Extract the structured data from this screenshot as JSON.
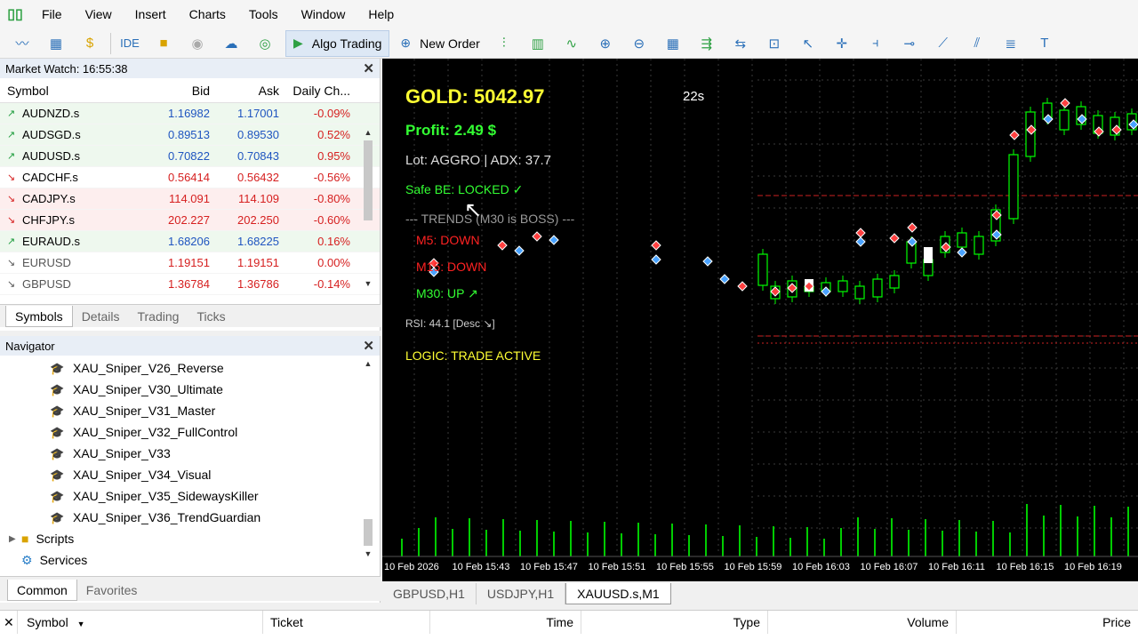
{
  "menu": [
    "File",
    "View",
    "Insert",
    "Charts",
    "Tools",
    "Window",
    "Help"
  ],
  "toolbar": {
    "ide": "IDE",
    "algo_trading": "Algo Trading",
    "new_order": "New Order"
  },
  "market_watch": {
    "title": "Market Watch: 16:55:38",
    "columns": [
      "Symbol",
      "Bid",
      "Ask",
      "Daily Ch..."
    ],
    "rows": [
      {
        "symbol": "AUDNZD.s",
        "bid": "1.16982",
        "ask": "1.17001",
        "change": "-0.09%",
        "dir": "up"
      },
      {
        "symbol": "AUDSGD.s",
        "bid": "0.89513",
        "ask": "0.89530",
        "change": "0.52%",
        "dir": "up"
      },
      {
        "symbol": "AUDUSD.s",
        "bid": "0.70822",
        "ask": "0.70843",
        "change": "0.95%",
        "dir": "up"
      },
      {
        "symbol": "CADCHF.s",
        "bid": "0.56414",
        "ask": "0.56432",
        "change": "-0.56%",
        "dir": "down"
      },
      {
        "symbol": "CADJPY.s",
        "bid": "114.091",
        "ask": "114.109",
        "change": "-0.80%",
        "dir": "down"
      },
      {
        "symbol": "CHFJPY.s",
        "bid": "202.227",
        "ask": "202.250",
        "change": "-0.60%",
        "dir": "down"
      },
      {
        "symbol": "EURAUD.s",
        "bid": "1.68206",
        "ask": "1.68225",
        "change": "0.16%",
        "dir": "up"
      },
      {
        "symbol": "EURUSD",
        "bid": "1.19151",
        "ask": "1.19151",
        "change": "0.00%",
        "dir": "down"
      },
      {
        "symbol": "GBPUSD",
        "bid": "1.36784",
        "ask": "1.36786",
        "change": "-0.14%",
        "dir": "down"
      }
    ],
    "tabs": [
      "Symbols",
      "Details",
      "Trading",
      "Ticks"
    ]
  },
  "navigator": {
    "title": "Navigator",
    "experts": [
      "XAU_Sniper_V26_Reverse",
      "XAU_Sniper_V30_Ultimate",
      "XAU_Sniper_V31_Master",
      "XAU_Sniper_V32_FullControl",
      "XAU_Sniper_V33",
      "XAU_Sniper_V34_Visual",
      "XAU_Sniper_V35_SidewaysKiller",
      "XAU_Sniper_V36_TrendGuardian"
    ],
    "scripts": "Scripts",
    "services": "Services",
    "tabs": [
      "Common",
      "Favorites"
    ]
  },
  "chart": {
    "gold": "GOLD: 5042.97",
    "timer": "22s",
    "profit": "Profit: 2.49 $",
    "lot": "Lot: AGGRO | ADX: 37.7",
    "safe_be": "Safe BE: LOCKED ✓",
    "trends": "--- TRENDS (M30 is BOSS) ---",
    "m5": "M5: DOWN",
    "m15": "M15: DOWN",
    "m30": "M30: UP ↗",
    "rsi": "RSI: 44.1 [Desc ↘]",
    "logic": "LOGIC: TRADE ACTIVE",
    "time_labels": [
      "10 Feb 2026",
      "10 Feb 15:43",
      "10 Feb 15:47",
      "10 Feb 15:51",
      "10 Feb 15:55",
      "10 Feb 15:59",
      "10 Feb 16:03",
      "10 Feb 16:07",
      "10 Feb 16:11",
      "10 Feb 16:15",
      "10 Feb 16:19"
    ],
    "colors": {
      "bull": "#00ff00",
      "bear": "#00ff00",
      "info": "#ffff00",
      "green": "#33ff33",
      "red": "#ff2222"
    }
  },
  "chart_tabs": [
    "GBPUSD,H1",
    "USDJPY,H1",
    "XAUUSD.s,M1"
  ],
  "terminal": {
    "columns": [
      "Symbol",
      "Ticket",
      "Time",
      "Type",
      "Volume",
      "Price"
    ]
  }
}
